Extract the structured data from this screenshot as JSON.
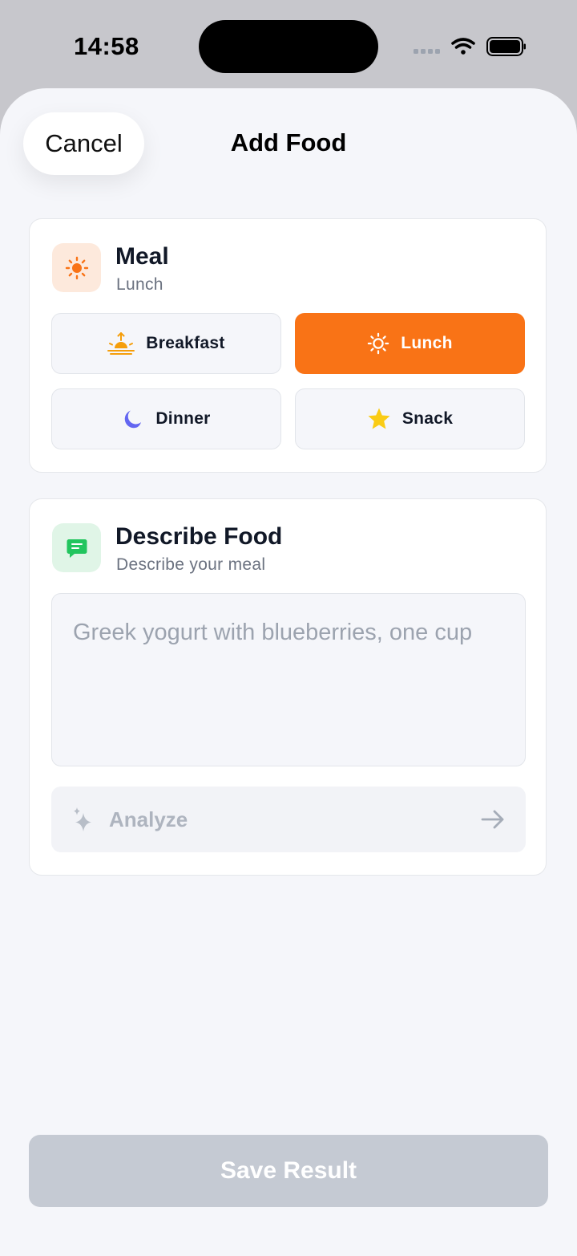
{
  "status_bar": {
    "time": "14:58"
  },
  "header": {
    "cancel_label": "Cancel",
    "title": "Add Food"
  },
  "meal_card": {
    "icon": "sun-icon",
    "title": "Meal",
    "subtitle": "Lunch",
    "options": [
      {
        "label": "Breakfast",
        "icon": "sunrise-icon",
        "selected": false
      },
      {
        "label": "Lunch",
        "icon": "sun-icon",
        "selected": true
      },
      {
        "label": "Dinner",
        "icon": "moon-icon",
        "selected": false
      },
      {
        "label": "Snack",
        "icon": "star-icon",
        "selected": false
      }
    ]
  },
  "describe_card": {
    "icon": "message-icon",
    "title": "Describe Food",
    "subtitle": "Describe your meal",
    "input_placeholder": "Greek yogurt with blueberries, one cup",
    "input_value": "",
    "analyze_label": "Analyze"
  },
  "footer": {
    "save_label": "Save Result"
  },
  "colors": {
    "accent": "#f97316",
    "sheet_background": "#f5f6fa",
    "disabled_button": "#c5cad3",
    "moon": "#6366f1",
    "star": "#facc15",
    "message_icon": "#22c55e"
  }
}
